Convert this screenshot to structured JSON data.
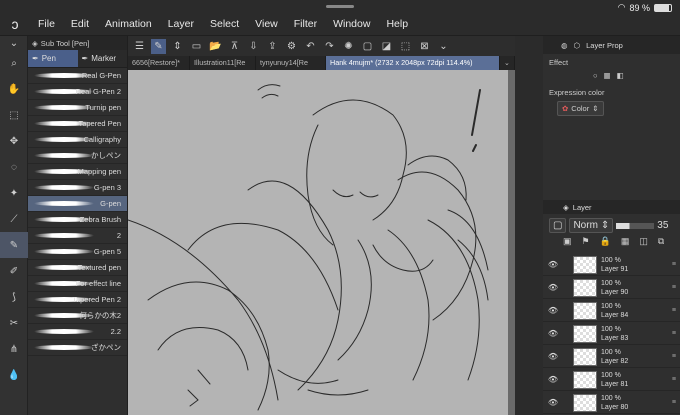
{
  "status": {
    "battery": "89 %"
  },
  "menu": [
    "File",
    "Edit",
    "Animation",
    "Layer",
    "Select",
    "View",
    "Filter",
    "Window",
    "Help"
  ],
  "subtool": {
    "title": "Sub Tool [Pen]",
    "tab_pen": "Pen",
    "tab_marker": "Marker",
    "brushes": [
      "Real G-Pen",
      "Real G-Pen 2",
      "Turnip pen",
      "Tapered Pen",
      "Calligraphy",
      "かしペン",
      "Mapping pen",
      "G-pen 3",
      "G-pen",
      "Zebra Brush",
      "2",
      "G-pen 5",
      "Textured pen",
      "For effect line",
      "Tapered Pen 2",
      "何らかの木2",
      "2.2",
      "ざかペン"
    ],
    "selected": "G-pen"
  },
  "tabs": [
    "6656[Restore]*",
    "Illustration11[Re",
    "tynyunuy14[Re",
    "Hank 4mujm* (2732 x 2048px 72dpi 114.4%)"
  ],
  "active_tab": "Hank 4mujm* (2732 x 2048px 72dpi 114.4%)",
  "property": {
    "tab": "Layer Prop",
    "effect_label": "Effect",
    "expression_label": "Expression color",
    "expression_value": "Color"
  },
  "layer": {
    "tab": "Layer",
    "blend": "Norm",
    "opacity": "35",
    "rows": [
      {
        "pct": "100 %",
        "name": "Layer 91"
      },
      {
        "pct": "100 %",
        "name": "Layer 90"
      },
      {
        "pct": "100 %",
        "name": "Layer 84"
      },
      {
        "pct": "100 %",
        "name": "Layer 83"
      },
      {
        "pct": "100 %",
        "name": "Layer 82"
      },
      {
        "pct": "100 %",
        "name": "Layer 81"
      },
      {
        "pct": "100 %",
        "name": "Layer 80"
      }
    ]
  }
}
